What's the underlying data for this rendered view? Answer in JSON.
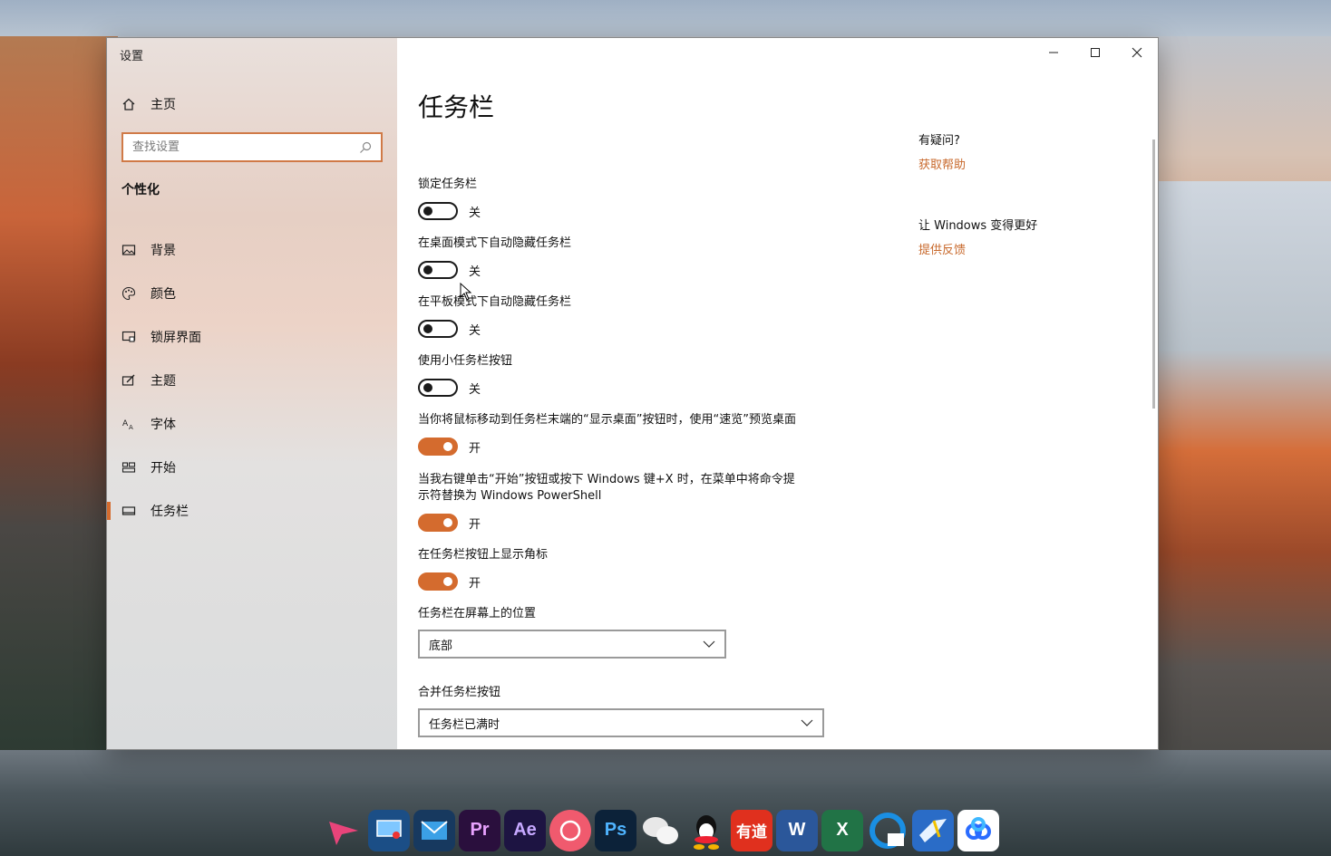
{
  "window": {
    "title": "设置"
  },
  "sidebar": {
    "home_label": "主页",
    "search_placeholder": "查找设置",
    "section_title": "个性化",
    "items": [
      {
        "label": "背景",
        "icon": "image-icon"
      },
      {
        "label": "颜色",
        "icon": "palette-icon"
      },
      {
        "label": "锁屏界面",
        "icon": "lock-screen-icon"
      },
      {
        "label": "主题",
        "icon": "theme-icon"
      },
      {
        "label": "字体",
        "icon": "font-icon"
      },
      {
        "label": "开始",
        "icon": "start-icon"
      },
      {
        "label": "任务栏",
        "icon": "taskbar-icon",
        "active": true
      }
    ]
  },
  "main": {
    "title": "任务栏",
    "settings": [
      {
        "label": "锁定任务栏",
        "state": "关",
        "on": false
      },
      {
        "label": "在桌面模式下自动隐藏任务栏",
        "state": "关",
        "on": false
      },
      {
        "label": "在平板模式下自动隐藏任务栏",
        "state": "关",
        "on": false
      },
      {
        "label": "使用小任务栏按钮",
        "state": "关",
        "on": false
      },
      {
        "label": "当你将鼠标移动到任务栏末端的“显示桌面”按钮时，使用“速览”预览桌面",
        "state": "开",
        "on": true
      },
      {
        "label_line1": "当我右键单击“开始”按钮或按下 Windows 键+X 时，在菜单中将命令提",
        "label_line2": "示符替换为 Windows PowerShell",
        "state": "开",
        "on": true
      },
      {
        "label": "在任务栏按钮上显示角标",
        "state": "开",
        "on": true
      }
    ],
    "position": {
      "label": "任务栏在屏幕上的位置",
      "value": "底部"
    },
    "combine": {
      "label": "合并任务栏按钮",
      "value": "任务栏已满时"
    }
  },
  "help": {
    "question": "有疑问?",
    "help_link": "获取帮助",
    "improve": "让 Windows 变得更好",
    "feedback_link": "提供反馈"
  },
  "dock": {
    "apps": [
      {
        "name": "send-app-icon",
        "text": "",
        "color": "#e8447a"
      },
      {
        "name": "screen-recorder-icon",
        "text": "",
        "color": "#1b4e86"
      },
      {
        "name": "mail-app-icon",
        "text": "",
        "color": "#1d5c9e"
      },
      {
        "name": "premiere-icon",
        "text": "Pr",
        "color": "#2a0f3d"
      },
      {
        "name": "after-effects-icon",
        "text": "Ae",
        "color": "#1d1442"
      },
      {
        "name": "meitu-icon",
        "text": "",
        "color": "#f05a6e"
      },
      {
        "name": "photoshop-icon",
        "text": "Ps",
        "color": "#0c2239"
      },
      {
        "name": "wechat-icon",
        "text": "",
        "color": "#ffffff"
      },
      {
        "name": "qq-icon",
        "text": "",
        "color": "#ffffff"
      },
      {
        "name": "youdao-icon",
        "text": "有道",
        "color": "#e0301e"
      },
      {
        "name": "word-icon",
        "text": "W",
        "color": "#2b579a"
      },
      {
        "name": "excel-icon",
        "text": "X",
        "color": "#217346"
      },
      {
        "name": "browser-icon",
        "text": "",
        "color": "#1a8fe3"
      },
      {
        "name": "feishu-icon",
        "text": "",
        "color": "#3a8de0"
      },
      {
        "name": "baidu-netdisk-icon",
        "text": "",
        "color": "#ffffff"
      }
    ]
  }
}
